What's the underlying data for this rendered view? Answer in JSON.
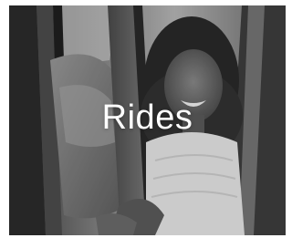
{
  "tile": {
    "title": "Rides",
    "photo_subject": "woman-entering-car"
  },
  "colors": {
    "title_text": "#ffffff",
    "page_background": "#ffffff"
  }
}
